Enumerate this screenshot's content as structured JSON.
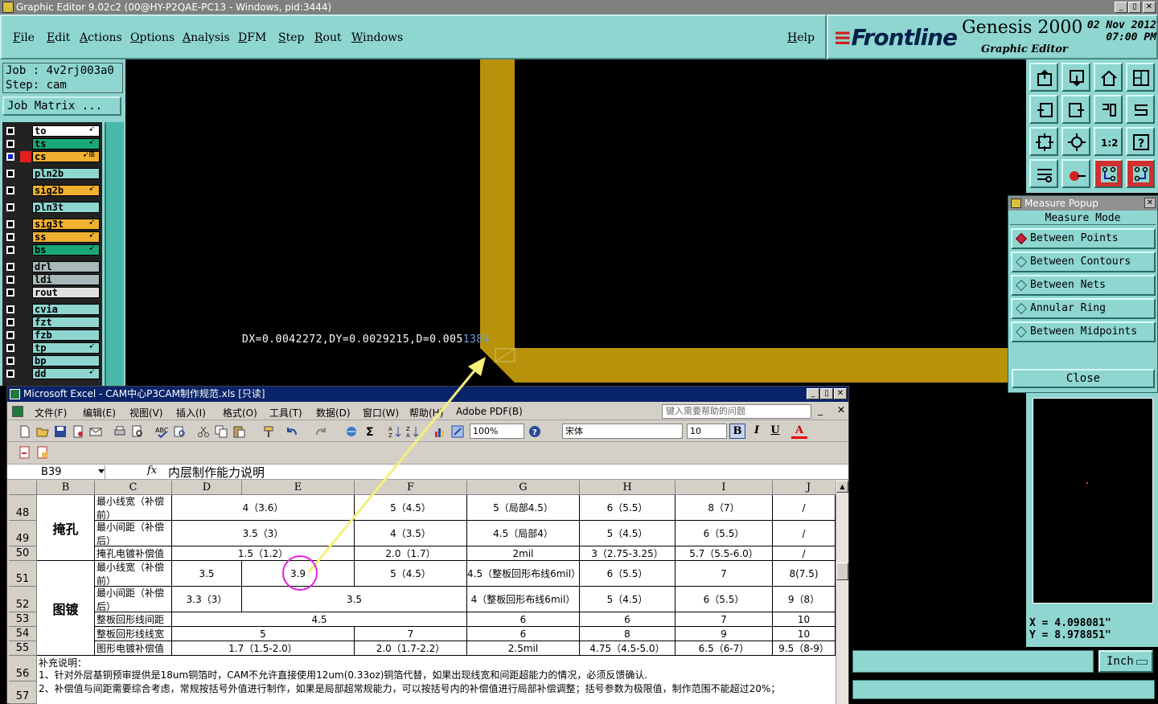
{
  "window": {
    "title": "Graphic Editor 9.02c2 (00@HY-P2QAE-PC13 - Windows, pid:3444)",
    "min_btn": "_",
    "max_btn": "▯",
    "close_btn": "✕"
  },
  "menu": {
    "items": [
      "File",
      "Edit",
      "Actions",
      "Options",
      "Analysis",
      "DFM",
      "Step",
      "Rout",
      "Windows"
    ],
    "help": "Help"
  },
  "brand": {
    "logo_lines": "≡",
    "logo": "Frontline",
    "product": "Genesis 2000",
    "subtitle": "Graphic Editor",
    "date": "02 Nov 2012",
    "time": "07:00 PM"
  },
  "job": {
    "job_line": "Job : 4v2rj003a0",
    "step_line": "Step: cam",
    "matrix_button": "Job Matrix ..."
  },
  "layers": [
    {
      "name": "to",
      "color": "#ffffff",
      "mark": "➹"
    },
    {
      "name": "ts",
      "color": "#1aa878",
      "mark": "➹"
    },
    {
      "name": "cs",
      "color": "#f0b030",
      "mark": "➹⊞",
      "active": true
    },
    {
      "name": "pln2b",
      "color": "#8fd6d0",
      "mark": ""
    },
    {
      "name": "sig2b",
      "color": "#f0b030",
      "mark": "➹"
    },
    {
      "name": "pln3t",
      "color": "#8fd6d0",
      "mark": ""
    },
    {
      "name": "sig3t",
      "color": "#f0b030",
      "mark": "➹"
    },
    {
      "name": "ss",
      "color": "#f0b030",
      "mark": "➹"
    },
    {
      "name": "bs",
      "color": "#1aa878",
      "mark": "➹"
    },
    {
      "name": "drl",
      "color": "#a8b8b8",
      "mark": ""
    },
    {
      "name": "ldi",
      "color": "#a8b8b8",
      "mark": ""
    },
    {
      "name": "rout",
      "color": "#e0e0e0",
      "mark": ""
    },
    {
      "name": "cvia",
      "color": "#8fd6d0",
      "mark": ""
    },
    {
      "name": "fzt",
      "color": "#8fd6d0",
      "mark": ""
    },
    {
      "name": "fzb",
      "color": "#8fd6d0",
      "mark": ""
    },
    {
      "name": "tp",
      "color": "#8fd6d0",
      "mark": "➹"
    },
    {
      "name": "bp",
      "color": "#8fd6d0",
      "mark": ""
    },
    {
      "name": "dd",
      "color": "#8fd6d0",
      "mark": "➹"
    }
  ],
  "canvas": {
    "readout_main": "DX=0.0042272,DY=0.0029215,D=0.005",
    "readout_tail": "1384",
    "trace_color": "#b8920a"
  },
  "measure": {
    "title": "Measure Popup",
    "close_x": "✕",
    "mode_label": "Measure Mode",
    "options": [
      "Between Points",
      "Between Contours",
      "Between Nets",
      "Annular Ring",
      "Between Midpoints"
    ],
    "close_label": "Close"
  },
  "coords": {
    "x": "X = 4.098081\"",
    "y": "Y = 8.978851\""
  },
  "units": {
    "label": "Inch"
  },
  "excel": {
    "title": "Microsoft Excel - CAM中心P3CAM制作规范.xls [只读]",
    "menus": [
      "文件(F)",
      "编辑(E)",
      "视图(V)",
      "插入(I)",
      "格式(O)",
      "工具(T)",
      "数据(D)",
      "窗口(W)",
      "帮助(H)",
      "Adobe PDF(B)"
    ],
    "help_placeholder": "键入需要帮助的问题",
    "zoom": "100%",
    "font_name": "宋体",
    "font_size": "10",
    "bold": "B",
    "italic": "I",
    "underline": "U",
    "font_color_btn": "A",
    "name_box": "B39",
    "fx": "fx",
    "formula": "内层制作能力说明",
    "columns": [
      "B",
      "C",
      "D",
      "E",
      "F",
      "G",
      "H",
      "I",
      "J"
    ],
    "rows": [
      "48",
      "49",
      "50",
      "51",
      "52",
      "53",
      "54",
      "55",
      "56",
      "57"
    ],
    "group1": "掩孔",
    "group2": "图镀",
    "r48": {
      "c": "最小线宽（补偿前）",
      "de": "4（3.6）",
      "f": "5（4.5）",
      "g": "5（局部4.5）",
      "h": "6（5.5）",
      "i": "8（7）",
      "j": "/"
    },
    "r49": {
      "c": "最小间距（补偿后）",
      "de": "3.5（3）",
      "f": "4（3.5）",
      "g": "4.5（局部4）",
      "h": "5（4.5）",
      "i": "6（5.5）",
      "j": "/"
    },
    "r50": {
      "c": "掩孔电镀补偿值",
      "de": "1.5（1.2）",
      "f": "2.0（1.7）",
      "g": "2mil",
      "h": "3（2.75-3.25）",
      "i": "5.7（5.5-6.0）",
      "j": "/"
    },
    "r51": {
      "c": "最小线宽（补偿前）",
      "d": "3.5",
      "e": "3.9",
      "f": "5（4.5）",
      "g": "4.5（整板回形布线6mil）",
      "h": "6（5.5）",
      "i": "7",
      "j": "8(7.5)"
    },
    "r52": {
      "c": "最小间距（补偿后）",
      "d": "3.3（3）",
      "ef": "3.5",
      "g": "4（整板回形布线6mil）",
      "h": "5（4.5）",
      "i": "6（5.5）",
      "j": "9（8）"
    },
    "r53": {
      "c": "整板回形线间距",
      "def": "4.5",
      "g": "6",
      "h": "6",
      "i": "7",
      "j": "10"
    },
    "r54": {
      "c": "整板回形线线宽",
      "de": "5",
      "f": "7",
      "g": "6",
      "h": "8",
      "i": "9",
      "j": "10"
    },
    "r55": {
      "c": "图形电镀补偿值",
      "de": "1.7（1.5-2.0）",
      "f": "2.0（1.7-2.2）",
      "g": "2.5mil",
      "h": "4.75（4.5-5.0）",
      "i": "6.5（6-7）",
      "j": "9.5（8-9）"
    },
    "notes_title": "补充说明：",
    "note1": "1、针对外层基铜预审提供是18um铜箔时，CAM不允许直接使用12um(0.33oz)铜箔代替，如果出现线宽和间距超能力的情况，必须反馈确认.",
    "note2": "2、补偿值与间距需要综合考虑，常规按括号外值进行制作，如果是局部超常规能力，可以按括号内的补偿值进行局部补偿调整；括号参数为极限值，制作范围不能超过20%；"
  }
}
